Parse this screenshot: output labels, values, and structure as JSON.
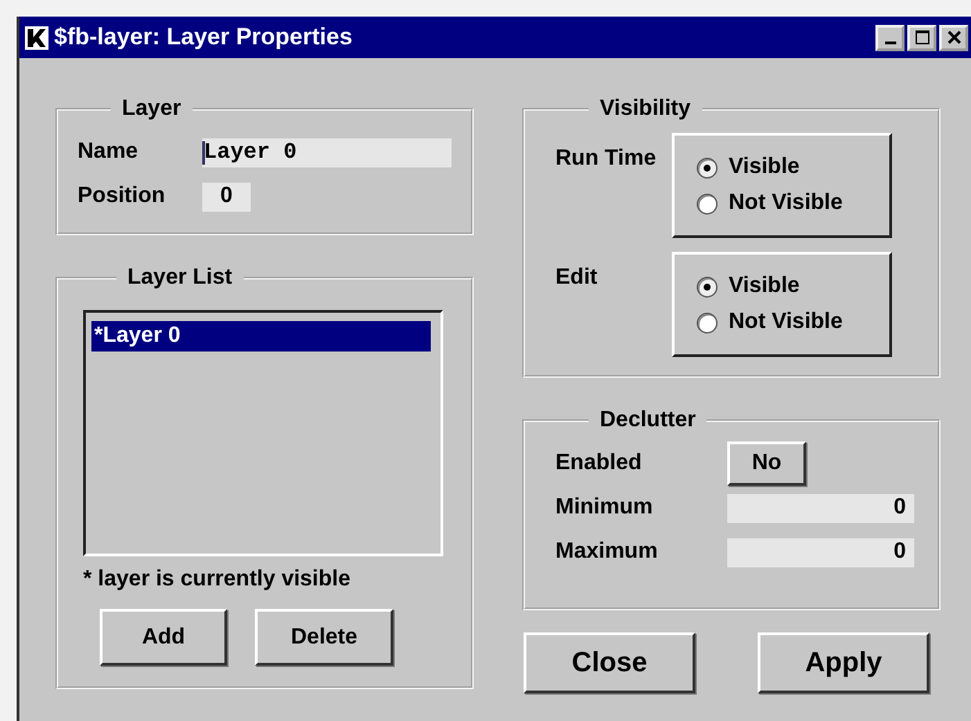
{
  "window": {
    "title": "$fb-layer: Layer Properties"
  },
  "layer": {
    "title": "Layer",
    "name_label": "Name",
    "name_value": "Layer 0",
    "position_label": "Position",
    "position_value": "0"
  },
  "layer_list": {
    "title": "Layer List",
    "items": [
      {
        "label": "*Layer 0",
        "selected": true
      }
    ],
    "note": "* layer is currently visible",
    "buttons": [
      "Add",
      "Delete"
    ]
  },
  "visibility": {
    "title": "Visibility",
    "groups": [
      {
        "label": "Run Time",
        "options": [
          {
            "label": "Visible",
            "selected": true
          },
          {
            "label": "Not Visible",
            "selected": false
          }
        ]
      },
      {
        "label": "Edit",
        "options": [
          {
            "label": "Visible",
            "selected": true
          },
          {
            "label": "Not Visible",
            "selected": false
          }
        ]
      }
    ]
  },
  "declutter": {
    "title": "Declutter",
    "enabled_label": "Enabled",
    "enabled_button": "No",
    "fields": [
      {
        "label": "Minimum",
        "value": "0"
      },
      {
        "label": "Maximum",
        "value": "0"
      }
    ]
  },
  "buttons": [
    "Close",
    "Apply"
  ]
}
